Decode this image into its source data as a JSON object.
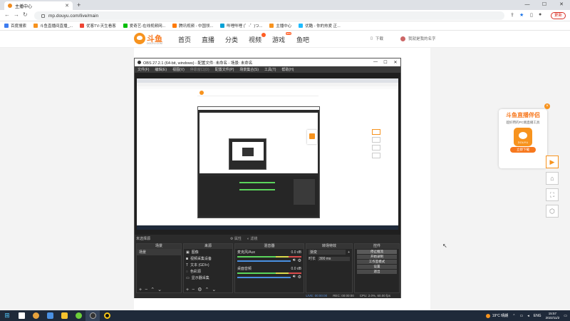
{
  "browser": {
    "tab_title": "主播中心",
    "url": "mp.douyu.com/live/main",
    "update_label": "更新",
    "bookmarks": [
      "百度搜索",
      "斗鱼直播间直播_...",
      "优客TV-天生看客",
      "爱奇艺-在线视频网...",
      "腾讯视频 - 中国领...",
      "哔哩哔哩 (゜-゜)つ...",
      "主播中心",
      "优酷 - 你的热爱 正..."
    ]
  },
  "site": {
    "logo": "斗鱼",
    "logo_sub": "DOUYU.COM",
    "nav": [
      "首页",
      "直播",
      "分类",
      "视频",
      "游戏",
      "鱼吧"
    ],
    "nav_badge": "new",
    "download_label": "下载",
    "username": "我就是我的名字",
    "promo_title": "斗鱼直播伴侣",
    "promo_sub": "超好用的PC端直播工具",
    "promo_app_label": "DOUYU",
    "promo_button": "立即下载"
  },
  "obs": {
    "title": "OBS 27.2.1 (64-bit, windows) - 配置文件: 未命名 - 场景: 未命名",
    "menu": [
      "文件(F)",
      "编辑(E)",
      "视图(V)",
      "停靠窗口(D)",
      "配置文件(P)",
      "场景集合(S)",
      "工具(T)",
      "帮助(H)"
    ],
    "source_label": "未选择源",
    "props_label": "属性",
    "filters_label": "滤镜",
    "docks": {
      "scenes": {
        "title": "场景",
        "items": [
          "场景"
        ]
      },
      "sources": {
        "title": "来源",
        "items": [
          "图像",
          "视频采集设备",
          "文本 (GDI+)",
          "色彩源",
          "显示器采集"
        ]
      },
      "mixer": {
        "title": "混音器",
        "channels": [
          {
            "name": "麦克风/Aux",
            "db": "0.0 dB"
          },
          {
            "name": "桌面音频",
            "db": "0.0 dB"
          }
        ]
      },
      "transitions": {
        "title": "转场特效",
        "type": "渐变",
        "duration_label": "时长",
        "duration": "300 ms"
      },
      "controls": {
        "title": "控件",
        "buttons": [
          "停止推流",
          "开始录制",
          "工作室模式",
          "设置",
          "退出"
        ]
      }
    },
    "status": {
      "live": "LIVE: 00:00:00",
      "rec": "REC: 00:00:00",
      "cpu": "CPU: 2.0%, 60.00 fps"
    }
  },
  "taskbar": {
    "weather": "19°C 晴朗",
    "lang": "ENG",
    "time": "15:57",
    "date": "2022/11/2"
  }
}
